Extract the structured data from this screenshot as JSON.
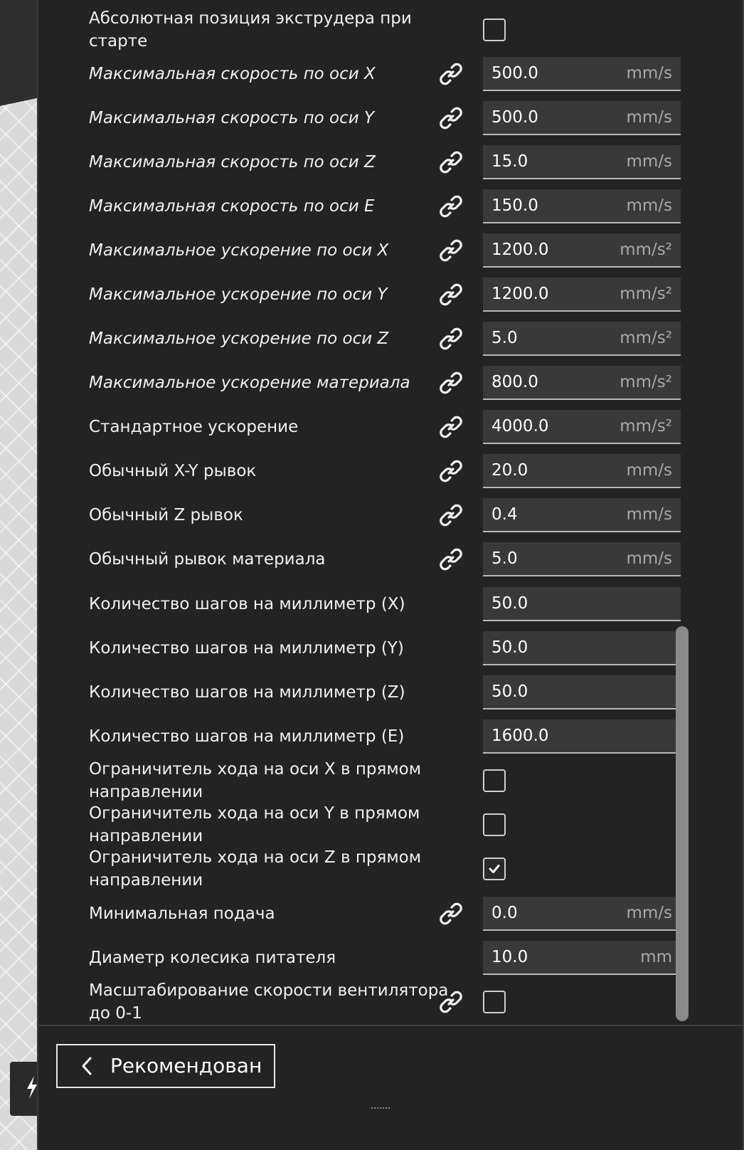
{
  "settings": [
    {
      "label": "Абсолютная позиция экструдера при старте",
      "italic": false,
      "linked": false,
      "kind": "checkbox",
      "checked": false
    },
    {
      "label": "Максимальная скорость по оси X",
      "italic": true,
      "linked": true,
      "kind": "field",
      "value": "500.0",
      "unit": "mm/s"
    },
    {
      "label": "Максимальная скорость по оси Y",
      "italic": true,
      "linked": true,
      "kind": "field",
      "value": "500.0",
      "unit": "mm/s"
    },
    {
      "label": "Максимальная скорость по оси Z",
      "italic": true,
      "linked": true,
      "kind": "field",
      "value": "15.0",
      "unit": "mm/s"
    },
    {
      "label": "Максимальная скорость по оси E",
      "italic": true,
      "linked": true,
      "kind": "field",
      "value": "150.0",
      "unit": "mm/s"
    },
    {
      "label": "Максимальное ускорение по оси X",
      "italic": true,
      "linked": true,
      "kind": "field",
      "value": "1200.0",
      "unit": "mm/s²"
    },
    {
      "label": "Максимальное ускорение по оси Y",
      "italic": true,
      "linked": true,
      "kind": "field",
      "value": "1200.0",
      "unit": "mm/s²"
    },
    {
      "label": "Максимальное ускорение по оси Z",
      "italic": true,
      "linked": true,
      "kind": "field",
      "value": "5.0",
      "unit": "mm/s²"
    },
    {
      "label": "Максимальное ускорение материала",
      "italic": true,
      "linked": true,
      "kind": "field",
      "value": "800.0",
      "unit": "mm/s²"
    },
    {
      "label": "Стандартное ускорение",
      "italic": false,
      "linked": true,
      "kind": "field",
      "value": "4000.0",
      "unit": "mm/s²"
    },
    {
      "label": "Обычный X-Y рывок",
      "italic": false,
      "linked": true,
      "kind": "field",
      "value": "20.0",
      "unit": "mm/s"
    },
    {
      "label": "Обычный Z рывок",
      "italic": false,
      "linked": true,
      "kind": "field",
      "value": "0.4",
      "unit": "mm/s"
    },
    {
      "label": "Обычный рывок материала",
      "italic": false,
      "linked": true,
      "kind": "field",
      "value": "5.0",
      "unit": "mm/s"
    },
    {
      "label": "Количество шагов на миллиметр (X)",
      "italic": false,
      "linked": false,
      "kind": "field",
      "value": "50.0",
      "unit": ""
    },
    {
      "label": "Количество шагов на миллиметр (Y)",
      "italic": false,
      "linked": false,
      "kind": "field",
      "value": "50.0",
      "unit": ""
    },
    {
      "label": "Количество шагов на миллиметр (Z)",
      "italic": false,
      "linked": false,
      "kind": "field",
      "value": "50.0",
      "unit": ""
    },
    {
      "label": "Количество шагов на миллиметр (E)",
      "italic": false,
      "linked": false,
      "kind": "field",
      "value": "1600.0",
      "unit": ""
    },
    {
      "label": "Ограничитель хода на оси X в прямом направлении",
      "italic": false,
      "linked": false,
      "kind": "checkbox",
      "checked": false
    },
    {
      "label": "Ограничитель хода на оси Y в прямом направлении",
      "italic": false,
      "linked": false,
      "kind": "checkbox",
      "checked": false
    },
    {
      "label": "Ограничитель хода на оси Z в прямом направлении",
      "italic": false,
      "linked": false,
      "kind": "checkbox",
      "checked": true
    },
    {
      "label": "Минимальная подача",
      "italic": false,
      "linked": true,
      "kind": "field",
      "value": "0.0",
      "unit": "mm/s"
    },
    {
      "label": "Диаметр колесика питателя",
      "italic": false,
      "linked": false,
      "kind": "field",
      "value": "10.0",
      "unit": "mm"
    },
    {
      "label": "Масштабирование скорости вентилятора до 0-1",
      "italic": false,
      "linked": true,
      "kind": "checkbox",
      "checked": false
    }
  ],
  "footer": {
    "recommended_label": "Рекомендован"
  },
  "icons": {
    "link": "link-icon",
    "back": "chevron-left-icon",
    "check": "checkmark-icon"
  },
  "colors": {
    "panel_bg": "#232323",
    "field_bg": "#393939",
    "text": "#f0f0f0",
    "unit_text": "#a8a8a8"
  }
}
